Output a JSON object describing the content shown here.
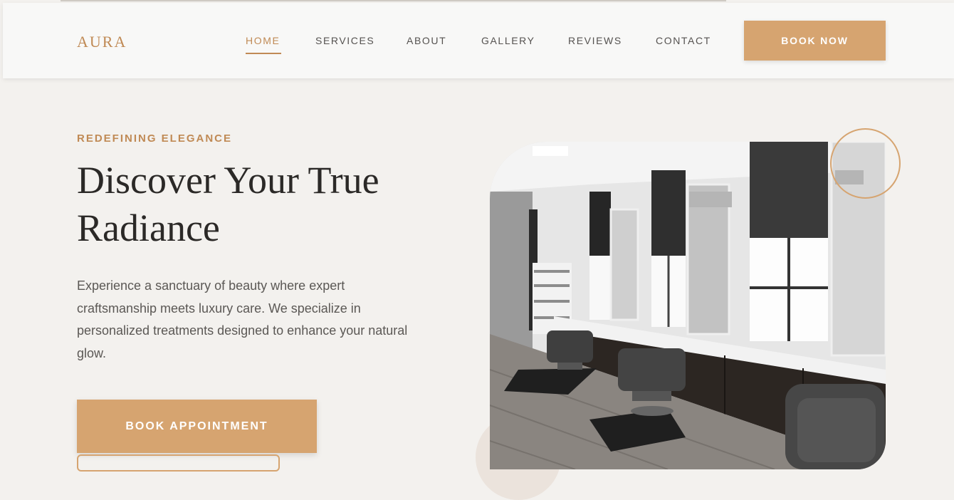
{
  "brand": {
    "logo": "AURA"
  },
  "nav": {
    "items": [
      {
        "label": "HOME",
        "active": true
      },
      {
        "label": "SERVICES",
        "active": false
      },
      {
        "label": "ABOUT",
        "active": false
      },
      {
        "label": "GALLERY",
        "active": false
      },
      {
        "label": "REVIEWS",
        "active": false
      },
      {
        "label": "CONTACT",
        "active": false
      }
    ],
    "cta": "BOOK NOW"
  },
  "hero": {
    "eyebrow": "REDEFINING ELEGANCE",
    "title": "Discover Your True Radiance",
    "description": "Experience a sanctuary of beauty where expert craftsmanship meets luxury care. We specialize in personalized treatments designed to enhance your natural glow.",
    "primary_cta": "BOOK APPOINTMENT",
    "image": "salon-interior-photo"
  },
  "colors": {
    "accent": "#d6a470",
    "accent_text": "#c08a55",
    "background": "#f3f1ee",
    "header": "#f8f8f7",
    "heading": "#2b2927",
    "body_text": "#5b5855"
  }
}
